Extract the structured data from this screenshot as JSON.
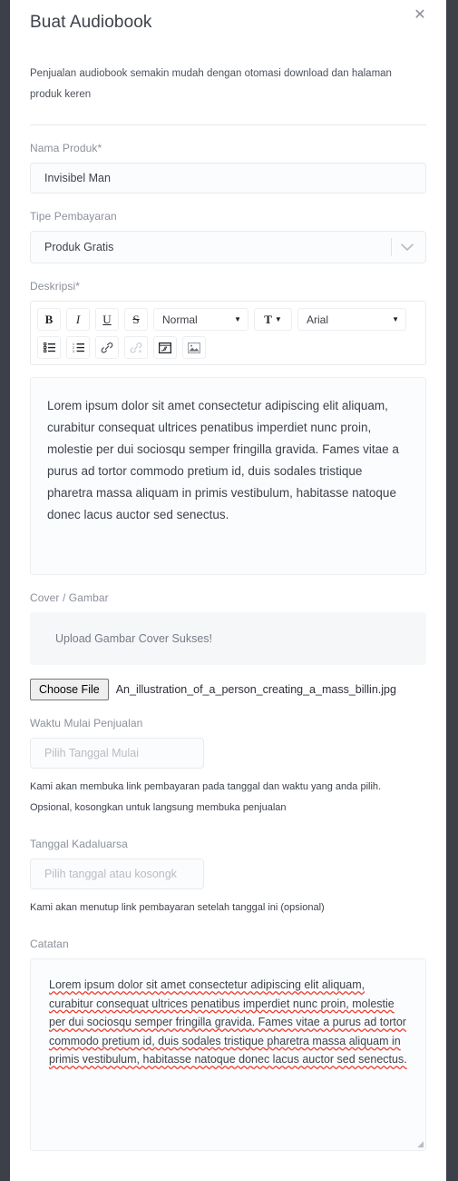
{
  "modal": {
    "title": "Buat Audiobook",
    "close_icon": "close-icon",
    "intro": "Penjualan audiobook semakin mudah dengan otomasi download dan halaman produk keren"
  },
  "product_name": {
    "label": "Nama Produk*",
    "value": "Invisibel Man"
  },
  "payment_type": {
    "label": "Tipe Pembayaran",
    "value": "Produk Gratis",
    "chevron_icon": "chevron-down-icon"
  },
  "description": {
    "label": "Deskripsi*",
    "toolbar": {
      "bold": "B",
      "italic": "I",
      "underline": "U",
      "strike": "S",
      "size_value": "Normal",
      "color_glyph": "T",
      "font_value": "Arial",
      "bullet_list": "bullet-list-icon",
      "ordered_list": "ordered-list-icon",
      "link": "link-icon",
      "unlink": "unlink-icon",
      "code_block": "code-block-icon",
      "image": "image-icon"
    },
    "text": "Lorem ipsum dolor sit amet consectetur adipiscing elit aliquam, curabitur consequat ultrices penatibus imperdiet nunc proin, molestie per dui sociosqu semper fringilla gravida. Fames vitae a purus ad tortor commodo pretium id, duis sodales tristique pharetra massa aliquam in primis vestibulum, habitasse natoque donec lacus auctor sed senectus."
  },
  "cover": {
    "label": "Cover / Gambar",
    "status": "Upload Gambar Cover Sukses!",
    "choose_file_label": "Choose File",
    "file_name": "An_illustration_of_a_person_creating_a_mass_billin.jpg"
  },
  "start_date": {
    "label": "Waktu Mulai Penjualan",
    "placeholder": "Pilih Tanggal Mulai",
    "value": "",
    "helper_line1": "Kami akan membuka link pembayaran pada tanggal dan waktu yang anda pilih.",
    "helper_line2": "Opsional, kosongkan untuk langsung membuka penjualan"
  },
  "expiry_date": {
    "label": "Tanggal Kadaluarsa",
    "placeholder": "Pilih tanggal atau kosongk",
    "value": "",
    "helper_line1": "Kami akan menutup link pembayaran setelah tanggal ini (opsional)"
  },
  "note": {
    "label": "Catatan",
    "text": "Lorem ipsum dolor sit amet consectetur adipiscing elit aliquam, curabitur consequat ultrices penatibus imperdiet nunc proin, molestie per dui sociosqu semper fringilla gravida. Fames vitae a purus ad tortor commodo pretium id, duis sodales tristique pharetra massa aliquam in primis vestibulum, habitasse natoque donec lacus auctor sed senectus."
  },
  "colors": {
    "backdrop": "#3b4049",
    "modal_bg": "#ffffff",
    "label_text": "#8b9099",
    "body_text": "#3d424b",
    "input_bg": "#fbfcfd",
    "input_border": "#e8eaec",
    "banner_bg": "#f5f7f9",
    "spellcheck": "#ef3b2d"
  }
}
